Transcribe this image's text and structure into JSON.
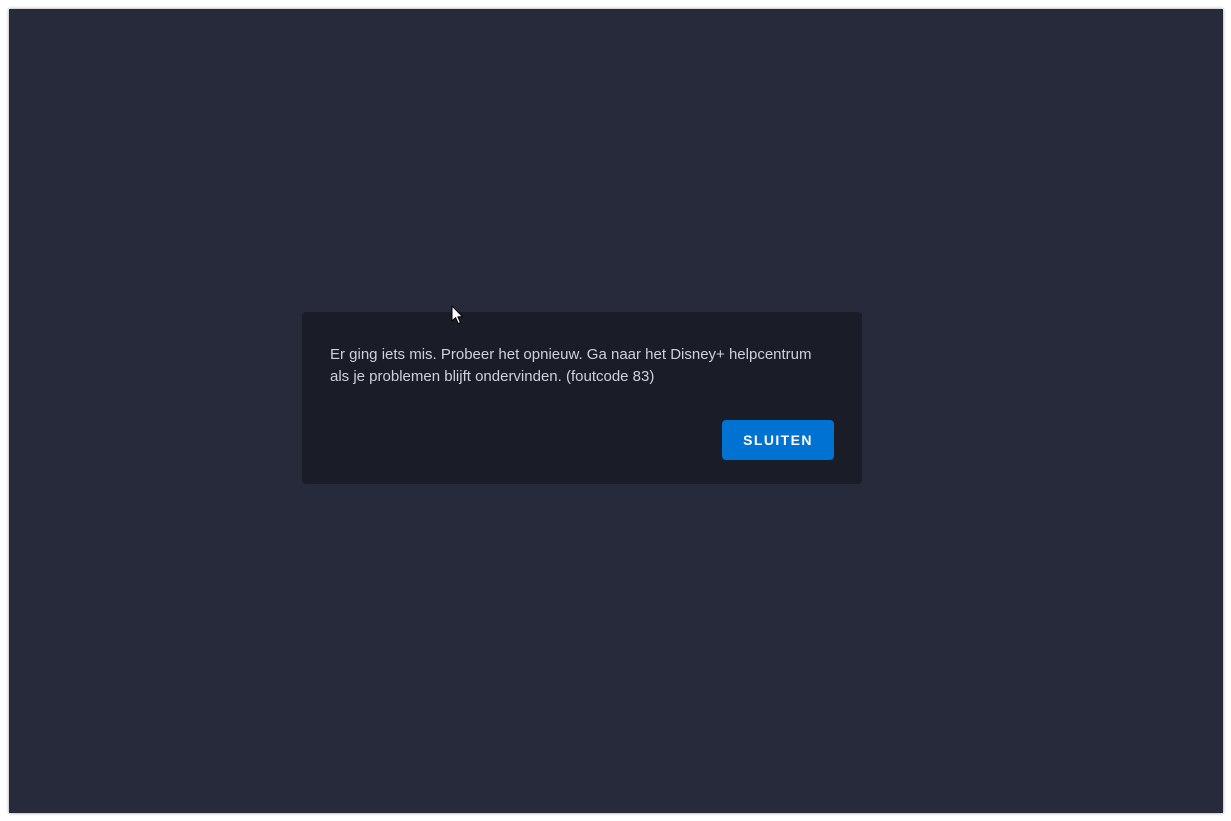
{
  "dialog": {
    "message": "Er ging iets mis. Probeer het opnieuw. Ga naar het Disney+ helpcentrum als je problemen blijft ondervinden. (foutcode 83)",
    "close_label": "SLUITEN"
  },
  "colors": {
    "background": "#272a3b",
    "dialog": "#1a1c28",
    "accent": "#0072d2",
    "text": "#cfd1d8"
  },
  "icons": {
    "cursor": "mouse-pointer-icon"
  }
}
